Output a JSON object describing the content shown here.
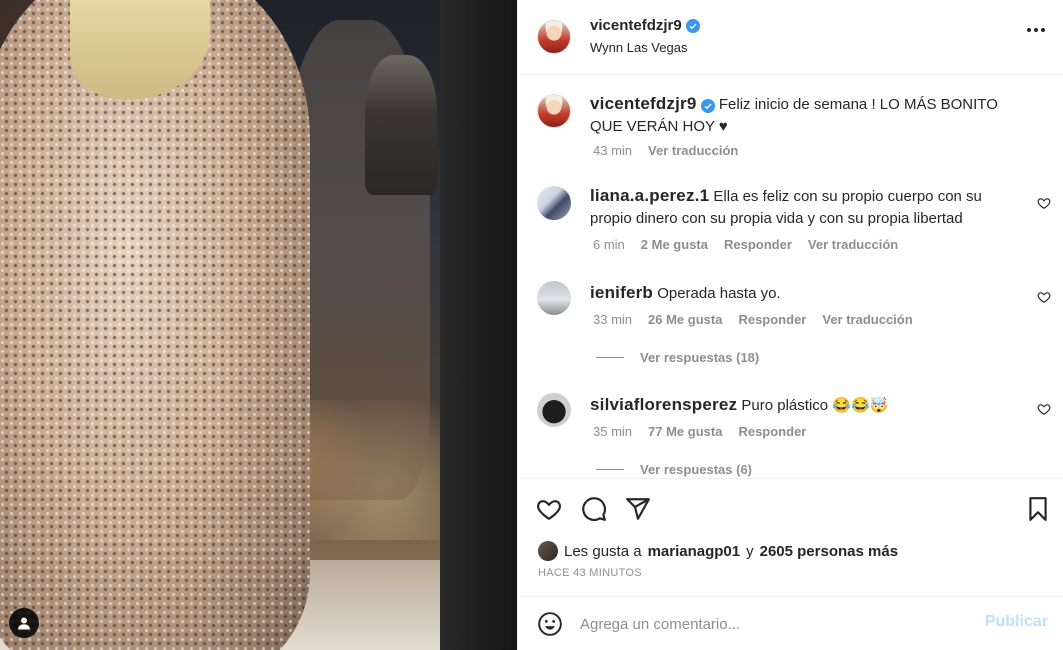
{
  "post": {
    "author": "vicentefdzjr9",
    "location": "Wynn Las Vegas",
    "caption": "Feliz inicio de semana ! LO MÁS BONITO QUE VERÁN HOY ♥",
    "caption_time": "43 min",
    "translate_label": "Ver traducción"
  },
  "comments": [
    {
      "user": "liana.a.perez.1",
      "text": "Ella es feliz con su propio cuerpo con su propio dinero con su propia vida y con su propia libertad",
      "time": "6 min",
      "likes": "2 Me gusta",
      "reply_label": "Responder",
      "translate_label": "Ver traducción"
    },
    {
      "user": "ieniferb",
      "text": "Operada hasta yo.",
      "time": "33 min",
      "likes": "26 Me gusta",
      "reply_label": "Responder",
      "translate_label": "Ver traducción",
      "view_replies": "Ver respuestas (18)"
    },
    {
      "user": "silviaflorensperez",
      "text": "Puro plástico 😂😂🤯",
      "time": "35 min",
      "likes": "77 Me gusta",
      "reply_label": "Responder",
      "view_replies": "Ver respuestas (6)"
    }
  ],
  "likes_summary": {
    "prefix": "Les gusta a",
    "user": "marianagp01",
    "joiner": "y",
    "others": "2605 personas más"
  },
  "posted_ago": "HACE 43 MINUTOS",
  "comment_box": {
    "placeholder": "Agrega un comentario...",
    "publish_label": "Publicar"
  },
  "icons": {
    "header_more": "more-horizontal-icon",
    "like": "heart-outline-icon",
    "comment": "speech-bubble-icon",
    "share": "paper-plane-icon",
    "save": "bookmark-icon",
    "emoji": "smiley-icon",
    "tag": "user-tag-icon"
  },
  "colors": {
    "verified": "#3897f0",
    "text": "#262626",
    "secondary": "#8e8e8e",
    "publish_disabled": "#c0dffd",
    "border": "#efefef"
  }
}
